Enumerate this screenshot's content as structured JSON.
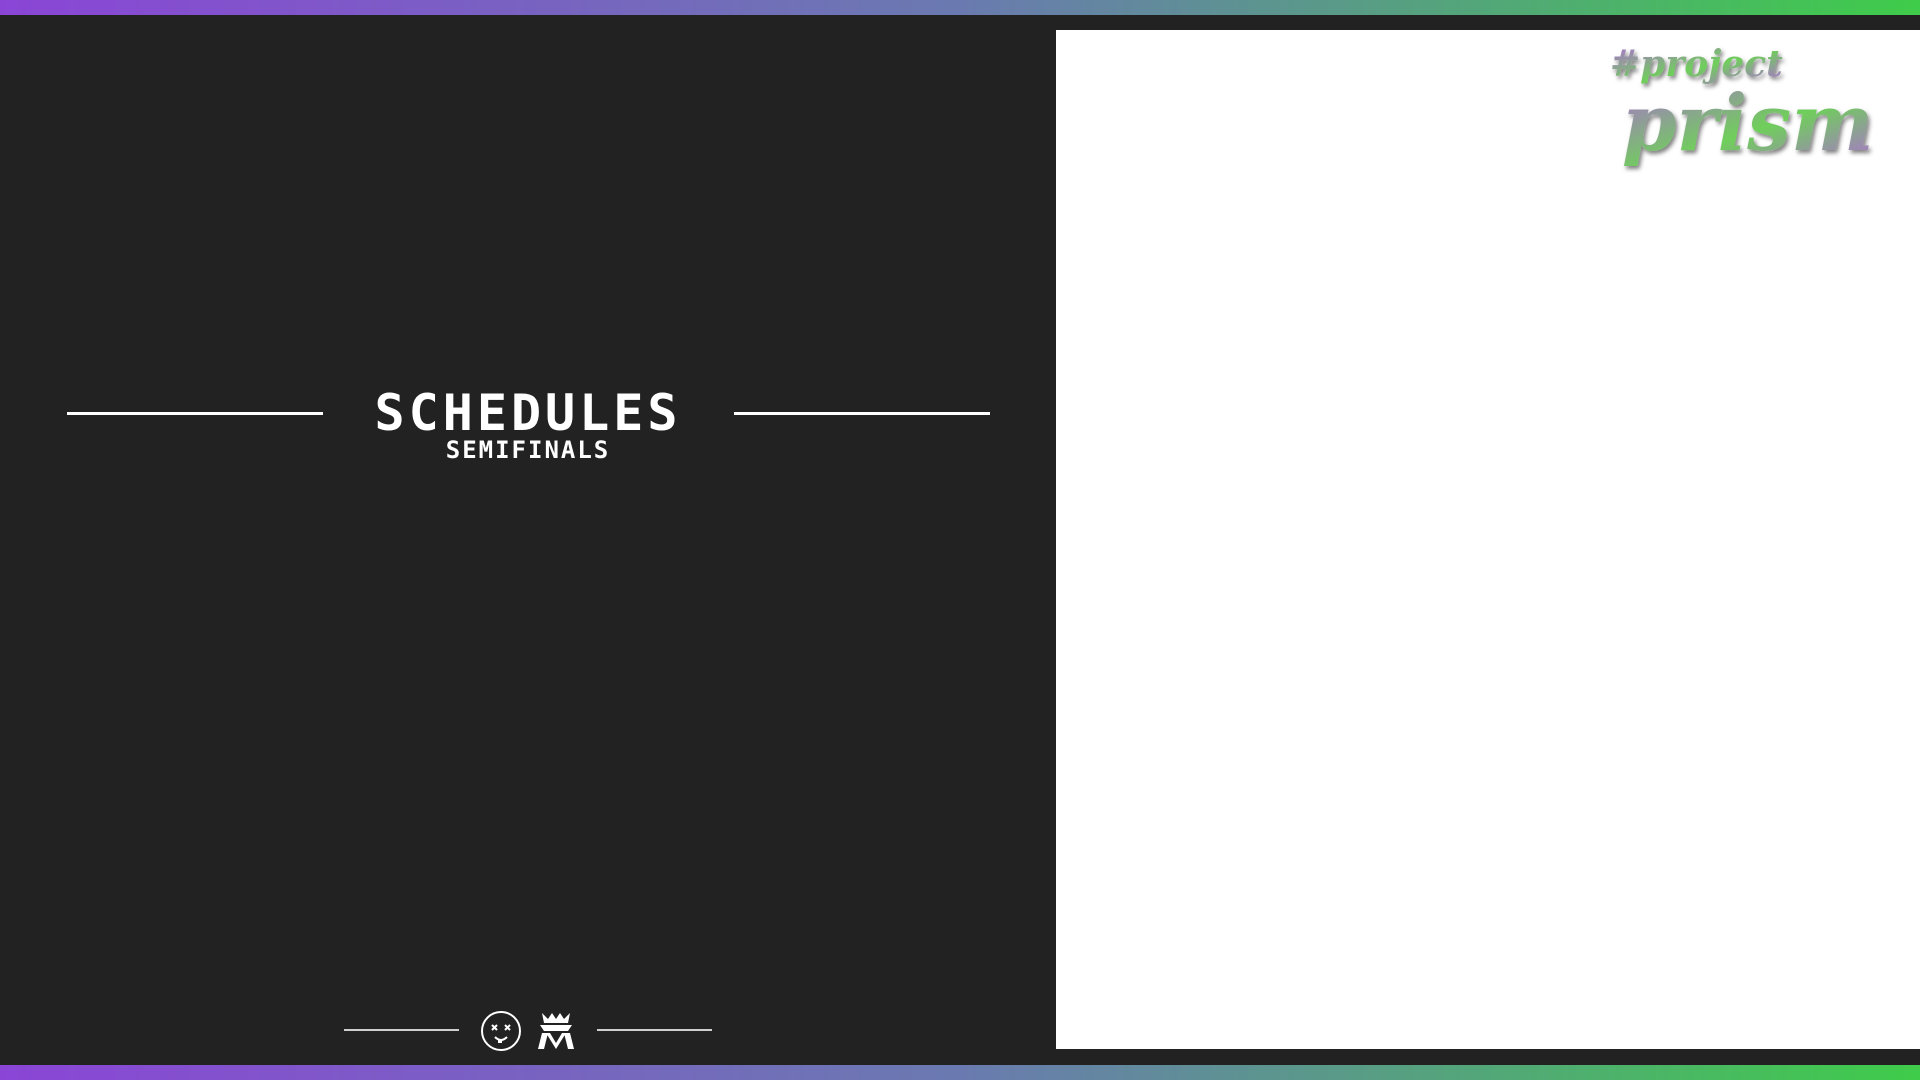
{
  "colors": {
    "background": "#222222",
    "text": "#ffffff",
    "gradient_start": "#8a45d6",
    "gradient_end": "#3fcc4a",
    "screen_area": "#ffffff"
  },
  "schedule": {
    "title": "SCHEDULES",
    "subtitle": "SEMIFINALS"
  },
  "brand": {
    "tag": "#project",
    "name": "prism"
  },
  "footer": {
    "logos": [
      "face-logo-icon",
      "crown-logo-icon"
    ]
  }
}
